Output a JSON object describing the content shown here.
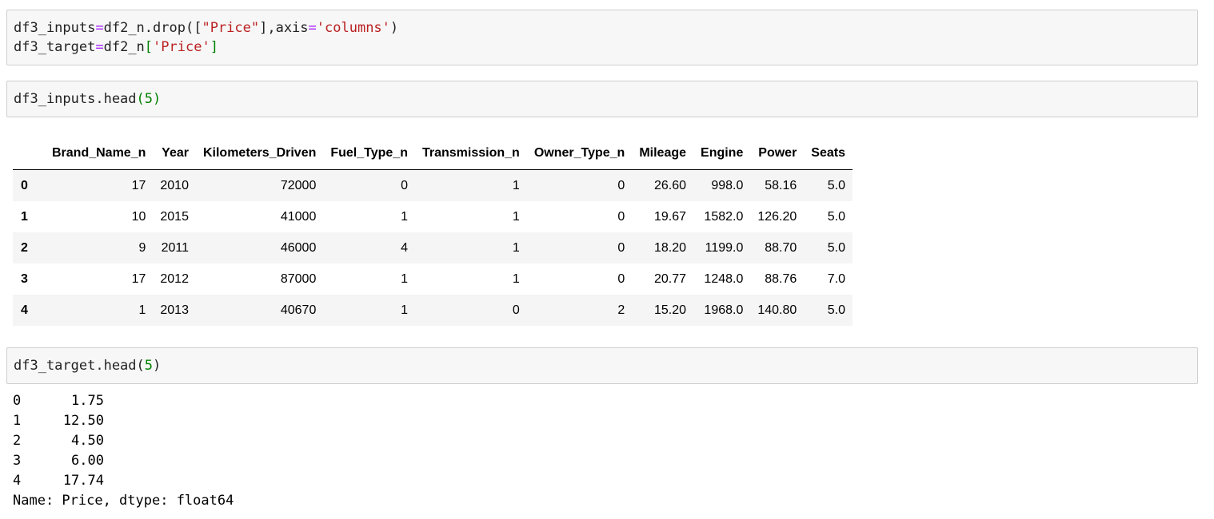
{
  "cells": [
    {
      "lines": [
        [
          {
            "t": "df3_inputs",
            "c": "plain"
          },
          {
            "t": "=",
            "c": "op"
          },
          {
            "t": "df2_n.drop(",
            "c": "plain"
          },
          {
            "t": "[",
            "c": "plain"
          },
          {
            "t": "\"Price\"",
            "c": "str"
          },
          {
            "t": "],axis",
            "c": "plain"
          },
          {
            "t": "=",
            "c": "op"
          },
          {
            "t": "'columns'",
            "c": "str"
          },
          {
            "t": ")",
            "c": "plain"
          }
        ],
        [
          {
            "t": "df3_target",
            "c": "plain"
          },
          {
            "t": "=",
            "c": "op"
          },
          {
            "t": "df2_n",
            "c": "plain"
          },
          {
            "t": "[",
            "c": "br"
          },
          {
            "t": "'Price'",
            "c": "str"
          },
          {
            "t": "]",
            "c": "br"
          }
        ]
      ]
    },
    {
      "lines": [
        [
          {
            "t": "df3_inputs.head",
            "c": "plain"
          },
          {
            "t": "(",
            "c": "br"
          },
          {
            "t": "5",
            "c": "num"
          },
          {
            "t": ")",
            "c": "br"
          }
        ]
      ]
    },
    {
      "lines": [
        [
          {
            "t": "df3_target.head",
            "c": "plain"
          },
          {
            "t": "(",
            "c": "plain"
          },
          {
            "t": "5",
            "c": "num"
          },
          {
            "t": ")",
            "c": "plain"
          }
        ]
      ]
    }
  ],
  "dataframe": {
    "columns": [
      "",
      "Brand_Name_n",
      "Year",
      "Kilometers_Driven",
      "Fuel_Type_n",
      "Transmission_n",
      "Owner_Type_n",
      "Mileage",
      "Engine",
      "Power",
      "Seats"
    ],
    "rows": [
      [
        "0",
        "17",
        "2010",
        "72000",
        "0",
        "1",
        "0",
        "26.60",
        "998.0",
        "58.16",
        "5.0"
      ],
      [
        "1",
        "10",
        "2015",
        "41000",
        "1",
        "1",
        "0",
        "19.67",
        "1582.0",
        "126.20",
        "5.0"
      ],
      [
        "2",
        "9",
        "2011",
        "46000",
        "4",
        "1",
        "0",
        "18.20",
        "1199.0",
        "88.70",
        "5.0"
      ],
      [
        "3",
        "17",
        "2012",
        "87000",
        "1",
        "1",
        "0",
        "20.77",
        "1248.0",
        "88.76",
        "7.0"
      ],
      [
        "4",
        "1",
        "2013",
        "40670",
        "1",
        "0",
        "2",
        "15.20",
        "1968.0",
        "140.80",
        "5.0"
      ]
    ]
  },
  "series_output": {
    "rows": [
      {
        "idx": "0",
        "val": "1.75"
      },
      {
        "idx": "1",
        "val": "12.50"
      },
      {
        "idx": "2",
        "val": "4.50"
      },
      {
        "idx": "3",
        "val": "6.00"
      },
      {
        "idx": "4",
        "val": "17.74"
      }
    ],
    "footer": "Name: Price, dtype: float64"
  }
}
